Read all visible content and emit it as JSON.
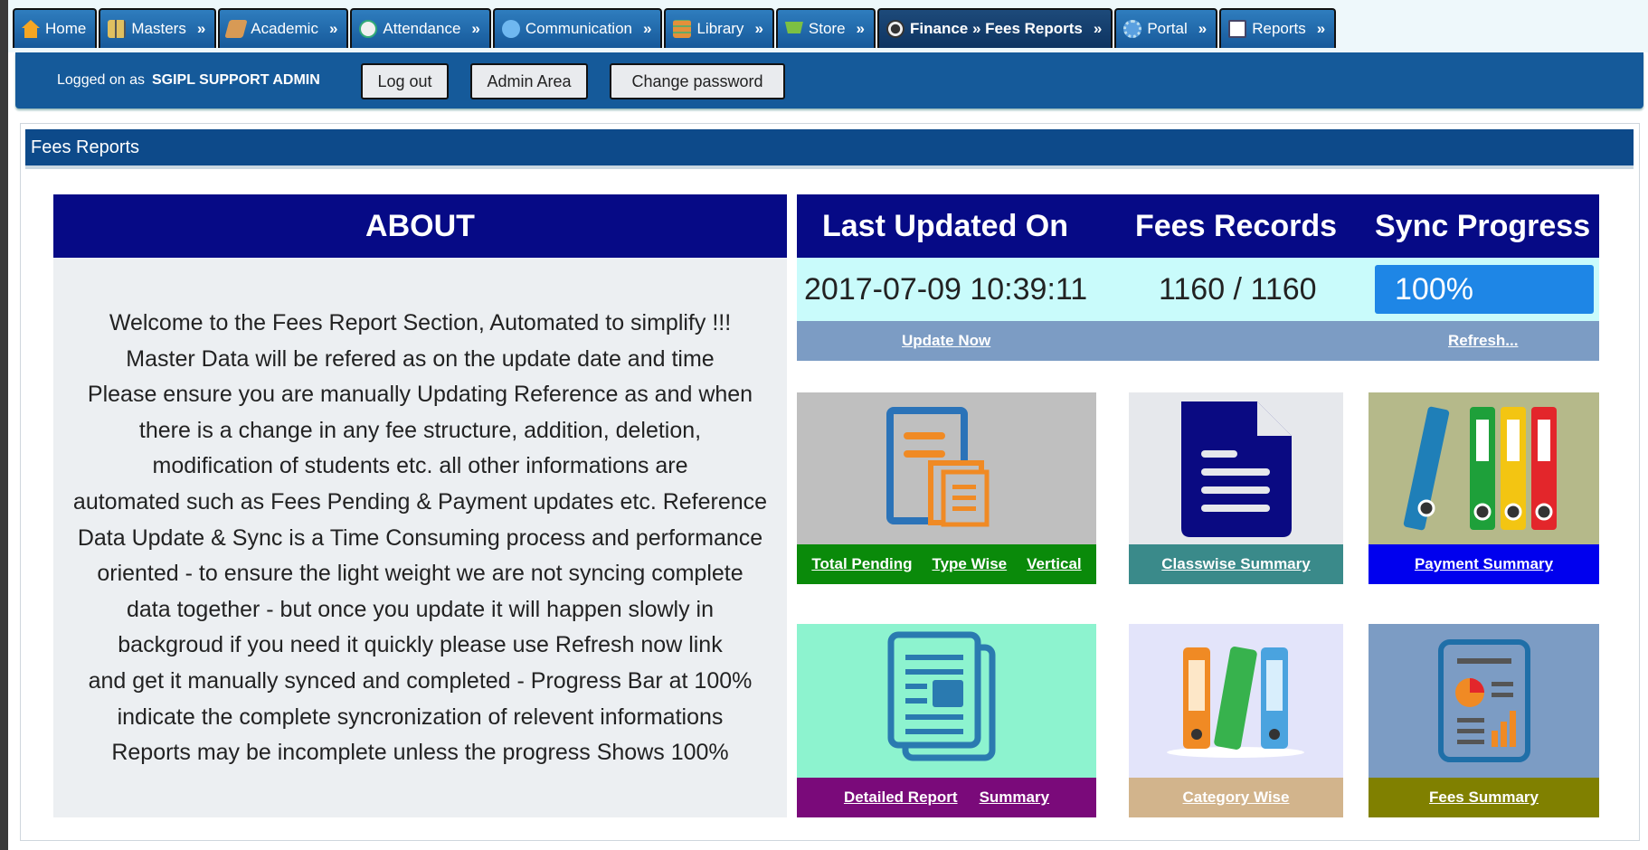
{
  "nav": [
    {
      "label": "Home",
      "icon": "home-icon",
      "color": "#f5a623"
    },
    {
      "label": "Masters",
      "icon": "masters-grid-icon",
      "color": "#e0c060",
      "arrow": "»"
    },
    {
      "label": "Academic",
      "icon": "book-icon",
      "color": "#d89a55",
      "arrow": "»"
    },
    {
      "label": "Attendance",
      "icon": "clock-icon",
      "color": "#f0f0f0",
      "arrow": "»"
    },
    {
      "label": "Communication",
      "icon": "phone-icon",
      "color": "#6fb8f0",
      "arrow": "»"
    },
    {
      "label": "Library",
      "icon": "books-icon",
      "color": "#e4903a",
      "arrow": "»"
    },
    {
      "label": "Store",
      "icon": "cart-icon",
      "color": "#7cc043",
      "arrow": "»"
    },
    {
      "label": "Finance » Fees Reports",
      "icon": "finance-icon",
      "color": "#333333",
      "arrow": "»",
      "active": true
    },
    {
      "label": "Portal",
      "icon": "gear-icon",
      "color": "#5aa0e0",
      "arrow": "»"
    },
    {
      "label": "Reports",
      "icon": "report-icon",
      "color": "#ffffff",
      "arrow": "»"
    }
  ],
  "user": {
    "logged_label": "Logged on as",
    "name": "SGIPL SUPPORT ADMIN",
    "logout": "Log out",
    "admin_area": "Admin Area",
    "change_password": "Change password"
  },
  "panel": {
    "title": "Fees Reports"
  },
  "about": {
    "title": "ABOUT",
    "lines": [
      "Welcome to the Fees Report Section, Automated to simplify !!!",
      "Master Data will be refered as on the update date and time",
      "Please ensure you are manually Updating Reference as and when",
      "there is a change in any fee structure, addition, deletion,",
      "modification of students etc. all other informations are",
      "automated such as Fees Pending & Payment updates etc. Reference",
      "Data Update & Sync is a Time Consuming process and performance",
      "oriented - to ensure the light weight we are not syncing complete",
      "data together - but once you update it will happen slowly in",
      "backgroud if you need it quickly please use Refresh now link",
      "and get it manually synced and completed - Progress Bar at 100%",
      "indicate the complete syncronization of relevent informations",
      "Reports may be incomplete unless the progress Shows 100%"
    ]
  },
  "stats": {
    "headers": {
      "last_updated": "Last Updated On",
      "records": "Fees Records",
      "sync": "Sync Progress"
    },
    "last_updated": "2017-07-09 10:39:11",
    "records": "1160 / 1160",
    "sync_progress": "100%",
    "sync_fraction": 1.0,
    "update_now": "Update Now",
    "refresh": "Refresh..."
  },
  "tiles": {
    "pending": {
      "links": [
        "Total Pending",
        "Type Wise",
        "Vertical"
      ],
      "bar_color": "#0a8a0a",
      "bg": "#bfbfbf"
    },
    "classwise": {
      "links": [
        "Classwise Summary"
      ],
      "bar_color": "#3a8a8a",
      "bg": "#e6e8ec"
    },
    "payment": {
      "links": [
        "Payment Summary"
      ],
      "bar_color": "#0000ee",
      "bg": "#b5b98a"
    },
    "detailed": {
      "links": [
        "Detailed Report",
        "Summary"
      ],
      "bar_color": "#7a0a7a",
      "bg": "#8df3cf"
    },
    "category": {
      "links": [
        "Category Wise"
      ],
      "bar_color": "#d2b48c",
      "bg": "#e3e4fa"
    },
    "fees": {
      "links": [
        "Fees Summary"
      ],
      "bar_color": "#808000",
      "bg": "#7c9cc4"
    }
  }
}
